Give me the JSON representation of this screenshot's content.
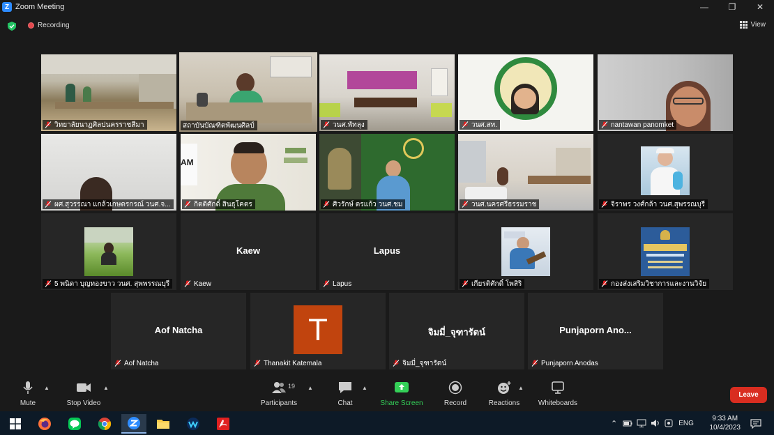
{
  "window": {
    "title": "Zoom Meeting"
  },
  "topbar": {
    "recording_label": "Recording",
    "view_label": "View"
  },
  "participants": [
    {
      "name": "วิทยาลัยนาฏศิลปนครราชสีมา"
    },
    {
      "name": "สถาบันบัณฑิตพัฒนศิลป์"
    },
    {
      "name": "วนศ.พัทลุง"
    },
    {
      "name": "วนศ.สท."
    },
    {
      "name": "nantawan panomket"
    },
    {
      "name": "ผศ.สุวรรณา แกล้วเกษตรกรณ์ วนศ.จ..."
    },
    {
      "name": "กิตติศักดิ์ สินธุโคตร"
    },
    {
      "name": "ศิวรักษ์ ตรแก้ว วนศ.ชม"
    },
    {
      "name": "วนศ.นครศรีธรรมราช"
    },
    {
      "name": "จิราพร วงศ์กล้า วนศ.สุพรรณบุรี"
    },
    {
      "name": "5 พนิดา บุญทองขาว วนศ. สุพพรรณบุรี"
    },
    {
      "name": "Kaew",
      "display": "Kaew"
    },
    {
      "name": "Lapus",
      "display": "Lapus"
    },
    {
      "name": "เกียรติศักดิ์ โพสิริ"
    },
    {
      "name": "กองส่งเสริมวิชาการและงานวิจัย"
    },
    {
      "name": "Aof Natcha",
      "display": "Aof Natcha"
    },
    {
      "name": "Thanakit Katemala",
      "initial": "T"
    },
    {
      "name": "จิมมี่_จุฑารัตน์",
      "display": "จิมมี่_จุฑารัตน์"
    },
    {
      "name": "Punjaporn  Anodas",
      "display": "Punjaporn   Ano..."
    }
  ],
  "toolbar": {
    "mute": "Mute",
    "stop_video": "Stop Video",
    "participants": "Participants",
    "participants_count": "19",
    "chat": "Chat",
    "share_screen": "Share Screen",
    "record": "Record",
    "reactions": "Reactions",
    "whiteboards": "Whiteboards",
    "leave": "Leave"
  },
  "taskbar": {
    "language": "ENG",
    "time": "9:33 AM",
    "date": "10/4/2023"
  },
  "colors": {
    "share_green": "#34d058",
    "leave_red": "#d92d20",
    "active_speaker": "#c5e86c",
    "zoom_blue": "#2d8cff"
  }
}
